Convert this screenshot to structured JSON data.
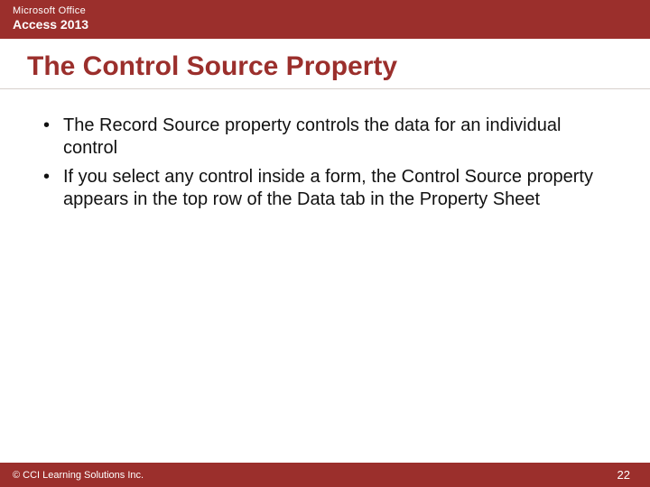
{
  "header": {
    "brand_top": "Microsoft Office",
    "brand_bottom": "Access 2013"
  },
  "title": "The Control Source Property",
  "bullets": [
    "The Record Source property controls the data for an individual control",
    "If you select any control inside a form, the Control Source property appears in the top row of the Data tab in the Property Sheet"
  ],
  "footer": {
    "copyright": "© CCI Learning Solutions Inc.",
    "page_number": "22"
  }
}
